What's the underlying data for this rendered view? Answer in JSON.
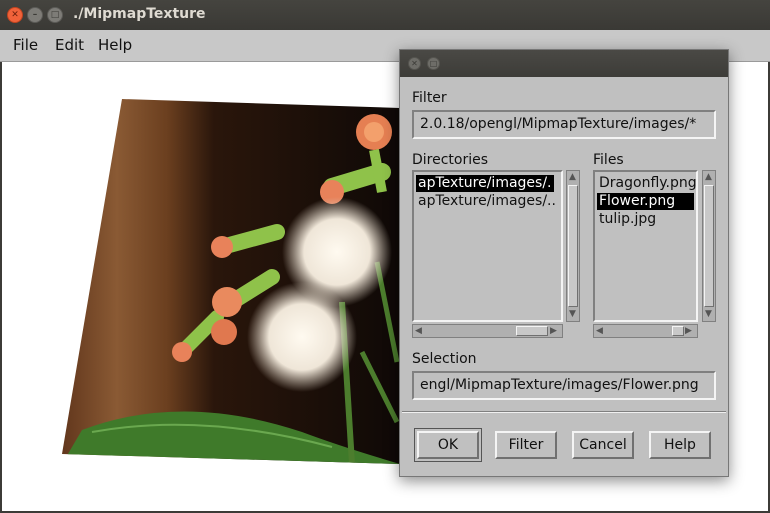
{
  "window": {
    "title": "./MipmapTexture"
  },
  "menubar": {
    "items": [
      {
        "label": "File"
      },
      {
        "label": "Edit"
      },
      {
        "label": "Help"
      }
    ]
  },
  "dialog": {
    "filter_label": "Filter",
    "filter_value": "2.0.18/opengl/MipmapTexture/images/*",
    "directories_label": "Directories",
    "directories": [
      "apTexture/images/.",
      "apTexture/images/.."
    ],
    "files_label": "Files",
    "files": [
      "Dragonfly.png",
      "Flower.png",
      "tulip.jpg"
    ],
    "selected_file": "Flower.png",
    "selection_label": "Selection",
    "selection_value": "engl/MipmapTexture/images/Flower.png",
    "buttons": {
      "ok": "OK",
      "filter": "Filter",
      "cancel": "Cancel",
      "help": "Help"
    }
  },
  "colors": {
    "selected_bg": "#000000",
    "dialog_bg": "#c0c0c0",
    "titlebar_bg": "#3c3b37",
    "close_btn": "#f0623a"
  }
}
